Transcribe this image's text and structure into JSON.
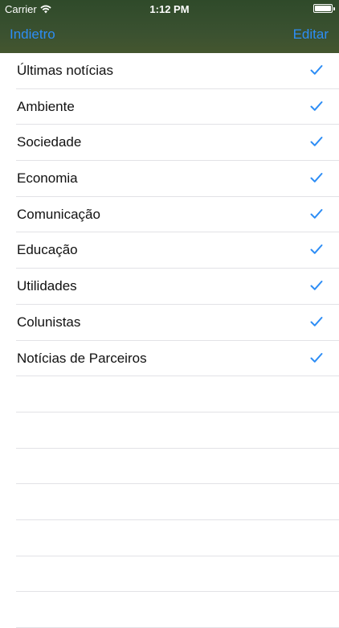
{
  "status": {
    "carrier": "Carrier",
    "time": "1:12 PM",
    "battery_level": 1.0
  },
  "nav": {
    "back_label": "Indietro",
    "edit_label": "Editar"
  },
  "accent": "#2d8df5",
  "categories": [
    {
      "label": "Últimas notícias",
      "checked": true
    },
    {
      "label": "Ambiente",
      "checked": true
    },
    {
      "label": "Sociedade",
      "checked": true
    },
    {
      "label": "Economia",
      "checked": true
    },
    {
      "label": "Comunicação",
      "checked": true
    },
    {
      "label": "Educação",
      "checked": true
    },
    {
      "label": "Utilidades",
      "checked": true
    },
    {
      "label": "Colunistas",
      "checked": true
    },
    {
      "label": "Notícias de Parceiros",
      "checked": true
    }
  ]
}
